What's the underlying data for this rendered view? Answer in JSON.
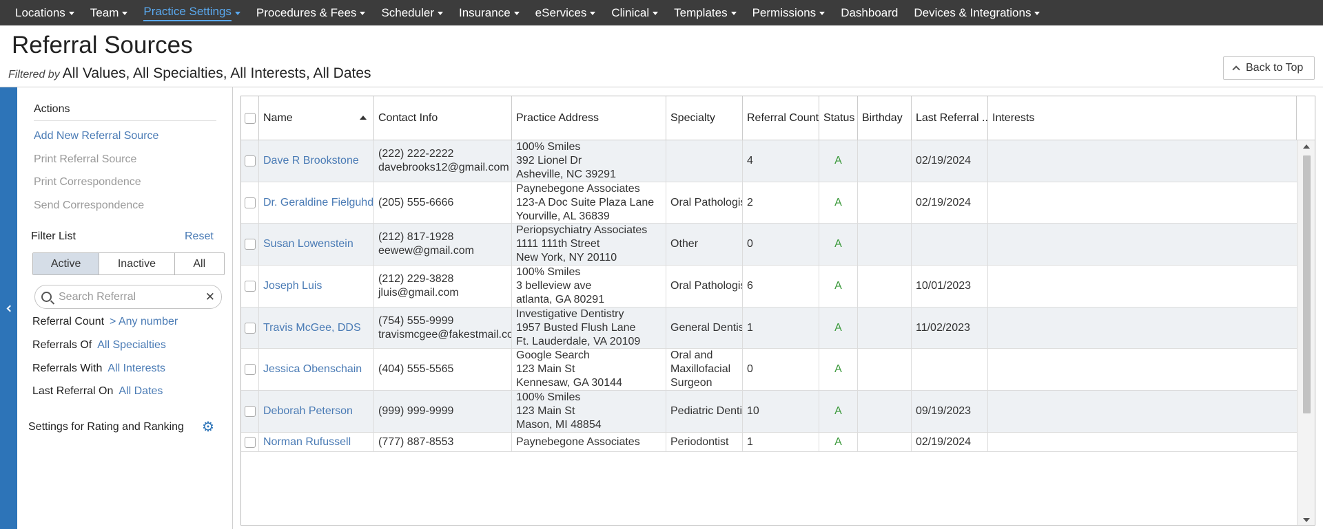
{
  "nav": [
    {
      "label": "Locations"
    },
    {
      "label": "Team"
    },
    {
      "label": "Practice Settings"
    },
    {
      "label": "Procedures & Fees"
    },
    {
      "label": "Scheduler"
    },
    {
      "label": "Insurance"
    },
    {
      "label": "eServices"
    },
    {
      "label": "Clinical"
    },
    {
      "label": "Templates"
    },
    {
      "label": "Permissions"
    },
    {
      "label": "Dashboard"
    },
    {
      "label": "Devices & Integrations"
    }
  ],
  "active_nav": "Practice Settings",
  "page": {
    "title": "Referral Sources",
    "filtered_by_label": "Filtered by",
    "filtered_by_value": "All Values, All Specialties, All Interests, All Dates",
    "back_to_top": "Back to Top"
  },
  "sidebar": {
    "actions_heading": "Actions",
    "actions": [
      {
        "label": "Add New Referral Source",
        "enabled": true
      },
      {
        "label": "Print Referral Source",
        "enabled": false
      },
      {
        "label": "Print Correspondence",
        "enabled": false
      },
      {
        "label": "Send Correspondence",
        "enabled": false
      }
    ],
    "filter_heading": "Filter List",
    "reset": "Reset",
    "segments": [
      "Active",
      "Inactive",
      "All"
    ],
    "active_segment": "Active",
    "search_placeholder": "Search Referral",
    "filters": [
      {
        "label": "Referral Count",
        "value": "> Any number"
      },
      {
        "label": "Referrals Of",
        "value": "All Specialties"
      },
      {
        "label": "Referrals With",
        "value": "All Interests"
      },
      {
        "label": "Last Referral On",
        "value": "All Dates"
      }
    ],
    "settings_label": "Settings for Rating and Ranking"
  },
  "table": {
    "columns": [
      "Name",
      "Contact Info",
      "Practice Address",
      "Specialty",
      "Referral Count",
      "Status",
      "Birthday",
      "Last Referral ...",
      "Interests"
    ],
    "sort": {
      "column": "Name",
      "direction": "ascending"
    },
    "rows": [
      {
        "name": "Dave R Brookstone",
        "contact": [
          "(222) 222-2222",
          "davebrooks12@gmail.com"
        ],
        "address": [
          "100% Smiles",
          "392 Lionel Dr",
          "Asheville, NC 39291"
        ],
        "specialty": [],
        "count": "4",
        "status": "A",
        "birthday": "",
        "last_referral": "02/19/2024",
        "interests": ""
      },
      {
        "name": "Dr. Geraldine Fielguhd",
        "contact": [
          "(205) 555-6666"
        ],
        "address": [
          "Paynebegone Associates",
          "123-A Doc Suite Plaza Lane",
          "Yourville, AL 36839"
        ],
        "specialty": [
          "Oral Pathologist"
        ],
        "count": "2",
        "status": "A",
        "birthday": "",
        "last_referral": "02/19/2024",
        "interests": ""
      },
      {
        "name": "Susan Lowenstein",
        "contact": [
          "(212) 817-1928",
          "eewew@gmail.com"
        ],
        "address": [
          "Periopsychiatry Associates",
          "1111 111th Street",
          "New York, NY 20110"
        ],
        "specialty": [
          "Other"
        ],
        "count": "0",
        "status": "A",
        "birthday": "",
        "last_referral": "",
        "interests": ""
      },
      {
        "name": "Joseph Luis",
        "contact": [
          "(212) 229-3828",
          "jluis@gmail.com"
        ],
        "address": [
          "100% Smiles",
          "3 belleview ave",
          "atlanta, GA 80291"
        ],
        "specialty": [
          "Oral Pathologist"
        ],
        "count": "6",
        "status": "A",
        "birthday": "",
        "last_referral": "10/01/2023",
        "interests": ""
      },
      {
        "name": "Travis McGee, DDS",
        "contact": [
          "(754) 555-9999",
          "travismcgee@fakestmail.com"
        ],
        "address": [
          "Investigative Dentistry",
          "1957 Busted Flush Lane",
          "Ft. Lauderdale, VA 20109"
        ],
        "specialty": [
          "General Dentist"
        ],
        "count": "1",
        "status": "A",
        "birthday": "",
        "last_referral": "11/02/2023",
        "interests": ""
      },
      {
        "name": "Jessica Obenschain",
        "contact": [
          "(404) 555-5565"
        ],
        "address": [
          "Google Search",
          "123 Main St",
          "Kennesaw, GA 30144"
        ],
        "specialty": [
          "Oral and",
          "Maxillofacial",
          "Surgeon"
        ],
        "count": "0",
        "status": "A",
        "birthday": "",
        "last_referral": "",
        "interests": ""
      },
      {
        "name": "Deborah Peterson",
        "contact": [
          "(999) 999-9999"
        ],
        "address": [
          "100% Smiles",
          "123 Main St",
          "Mason, MI 48854"
        ],
        "specialty": [
          "Pediatric Dentist"
        ],
        "count": "10",
        "status": "A",
        "birthday": "",
        "last_referral": "09/19/2023",
        "interests": ""
      },
      {
        "name": "Norman Rufussell",
        "contact": [
          "(777) 887-8553"
        ],
        "address": [
          "Paynebegone Associates"
        ],
        "specialty": [
          "Periodontist"
        ],
        "count": "1",
        "status": "A",
        "birthday": "",
        "last_referral": "02/19/2024",
        "interests": ""
      }
    ]
  },
  "colors": {
    "nav_bg": "#3c3c3c",
    "nav_active": "#5aa9ef",
    "link": "#4a7bb5",
    "accent": "#2d74b8",
    "status_active": "#3c9a3c",
    "row_alt": "#eef1f4"
  },
  "icons": {
    "nav_caret": "chevron-down-icon",
    "back_to_top": "chevron-up-icon",
    "collapse": "chevron-left-icon",
    "search": "search-icon",
    "clear": "close-icon",
    "settings": "gear-icon",
    "sort": "sort-ascending-icon"
  }
}
